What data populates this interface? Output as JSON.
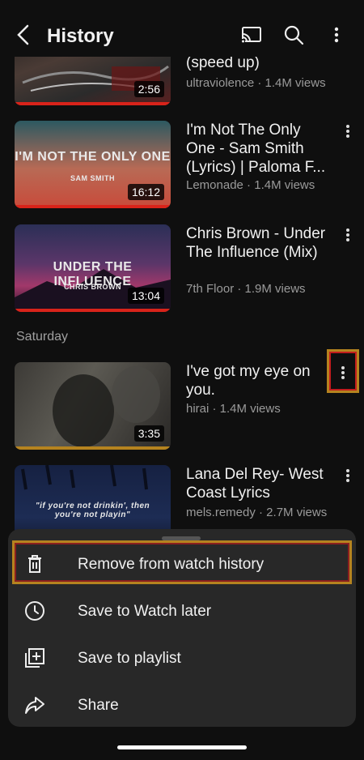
{
  "header": {
    "title": "History",
    "icons": [
      "back-icon",
      "cast-icon",
      "search-icon",
      "more-vert-icon"
    ]
  },
  "videos": [
    {
      "title": "(speed up)",
      "meta": "ultraviolence · 1.4M views",
      "duration": "2:56",
      "thumb_text": ""
    },
    {
      "title": "I'm Not The Only One - Sam Smith (Lyrics) | Paloma F...",
      "meta": "Lemonade · 1.4M views",
      "duration": "16:12",
      "thumb_text": "I'M NOT THE ONLY ONE",
      "thumb_sub": "SAM SMITH"
    },
    {
      "title": "Chris Brown - Under The Influence (Mix)",
      "meta": "7th Floor · 1.9M views",
      "duration": "13:04",
      "thumb_text": "UNDER THE INFLUENCE",
      "thumb_sub": "CHRIS BROWN"
    },
    {
      "title": "I've got my eye on you.",
      "meta": "hirai · 1.4M views",
      "duration": "3:35",
      "thumb_text": ""
    },
    {
      "title": "Lana Del Rey- West Coast Lyrics",
      "meta": "mels.remedy · 2.7M views",
      "duration": "",
      "thumb_text": "\"if you're not drinkin', then you're not playin\""
    }
  ],
  "section_saturday": "Saturday",
  "sheet": {
    "items": [
      {
        "label": "Remove from watch history",
        "icon": "trash-icon"
      },
      {
        "label": "Save to Watch later",
        "icon": "clock-icon"
      },
      {
        "label": "Save to playlist",
        "icon": "playlist-add-icon"
      },
      {
        "label": "Share",
        "icon": "share-icon"
      }
    ]
  },
  "colors": {
    "background": "#0f0f0f",
    "sheet": "#282828",
    "progress": "#d8231a",
    "highlight": "#b5831f"
  }
}
